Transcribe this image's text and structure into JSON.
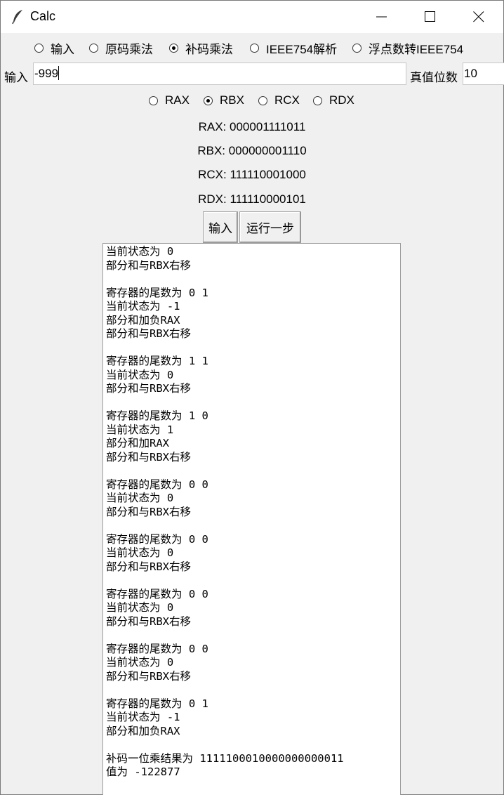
{
  "window": {
    "title": "Calc",
    "icon": "feather-icon"
  },
  "mode_options": [
    {
      "label": "输入",
      "selected": false
    },
    {
      "label": "原码乘法",
      "selected": false
    },
    {
      "label": "补码乘法",
      "selected": true
    },
    {
      "label": "IEEE754解析",
      "selected": false
    },
    {
      "label": "浮点数转IEEE754",
      "selected": false
    }
  ],
  "input": {
    "label": "输入",
    "value": "-999"
  },
  "bits": {
    "label": "真值位数",
    "value": "10"
  },
  "register_options": [
    {
      "label": "RAX",
      "selected": false
    },
    {
      "label": "RBX",
      "selected": true
    },
    {
      "label": "RCX",
      "selected": false
    },
    {
      "label": "RDX",
      "selected": false
    }
  ],
  "registers": [
    "RAX: 000001111011",
    "RBX: 000000001110",
    "RCX: 111110001000",
    "RDX: 111110000101"
  ],
  "buttons": {
    "input": "输入",
    "step": "运行一步"
  },
  "log": [
    "当前状态为 0",
    "部分和与RBX右移",
    "",
    "寄存器的尾数为 0 1",
    "当前状态为 -1",
    "部分和加负RAX",
    "部分和与RBX右移",
    "",
    "寄存器的尾数为 1 1",
    "当前状态为 0",
    "部分和与RBX右移",
    "",
    "寄存器的尾数为 1 0",
    "当前状态为 1",
    "部分和加RAX",
    "部分和与RBX右移",
    "",
    "寄存器的尾数为 0 0",
    "当前状态为 0",
    "部分和与RBX右移",
    "",
    "寄存器的尾数为 0 0",
    "当前状态为 0",
    "部分和与RBX右移",
    "",
    "寄存器的尾数为 0 0",
    "当前状态为 0",
    "部分和与RBX右移",
    "",
    "寄存器的尾数为 0 0",
    "当前状态为 0",
    "部分和与RBX右移",
    "",
    "寄存器的尾数为 0 1",
    "当前状态为 -1",
    "部分和加负RAX",
    "",
    "补码一位乘结果为 1111100010000000000011",
    "值为 -122877"
  ]
}
